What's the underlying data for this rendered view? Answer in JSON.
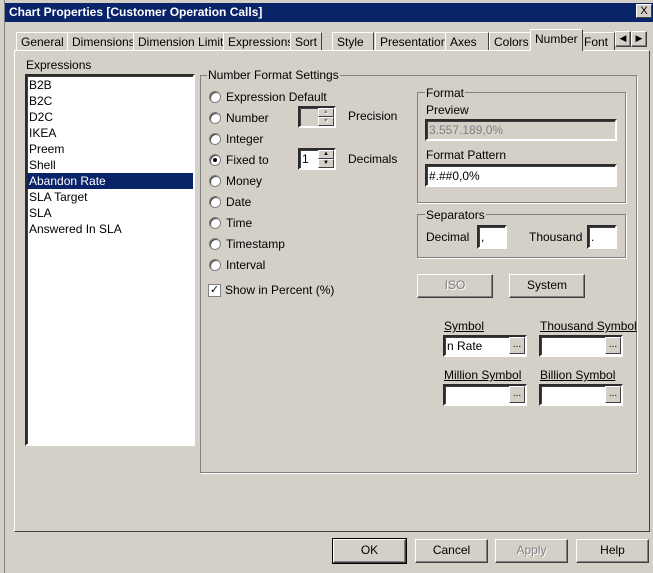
{
  "window": {
    "title": "Chart Properties [Customer Operation Calls]",
    "close": "X"
  },
  "tabs": [
    "General",
    "Dimensions",
    "Dimension Limits",
    "Expressions",
    "Sort",
    "Style",
    "Presentation",
    "Axes",
    "Colors",
    "Number",
    "Font"
  ],
  "tab_scroll": {
    "left": "◀",
    "right": "▶"
  },
  "expressions": {
    "label": "Expressions",
    "items": [
      "B2B",
      "B2C",
      "D2C",
      "IKEA",
      "Preem",
      "Shell",
      "Abandon Rate",
      "SLA Target",
      "SLA",
      "Answered In SLA"
    ],
    "selected": "Abandon Rate"
  },
  "nfs": {
    "label": "Number Format Settings",
    "options": [
      "Expression Default",
      "Number",
      "Integer",
      "Fixed to",
      "Money",
      "Date",
      "Time",
      "Timestamp",
      "Interval"
    ],
    "selected": "Fixed to",
    "precision_label": "Precision",
    "precision_value": "",
    "decimals_label": "Decimals",
    "decimals_value": "1",
    "show_percent": "Show in Percent (%)",
    "show_percent_checked": true
  },
  "format": {
    "label": "Format",
    "preview_label": "Preview",
    "preview_value": "3.557.189,0%",
    "pattern_label": "Format Pattern",
    "pattern_value": "#.##0,0%"
  },
  "separators": {
    "label": "Separators",
    "decimal_label": "Decimal",
    "decimal_value": ",",
    "thousand_label": "Thousand",
    "thousand_value": "."
  },
  "buttons": {
    "iso": "ISO",
    "system": "System",
    "ok": "OK",
    "cancel": "Cancel",
    "apply": "Apply",
    "help": "Help",
    "dots": "..."
  },
  "symbols": {
    "symbol_label": "Symbol",
    "symbol_value": "n Rate",
    "thousand_label": "Thousand Symbol",
    "thousand_value": "",
    "million_label": "Million Symbol",
    "million_value": "",
    "billion_label": "Billion Symbol",
    "billion_value": ""
  }
}
